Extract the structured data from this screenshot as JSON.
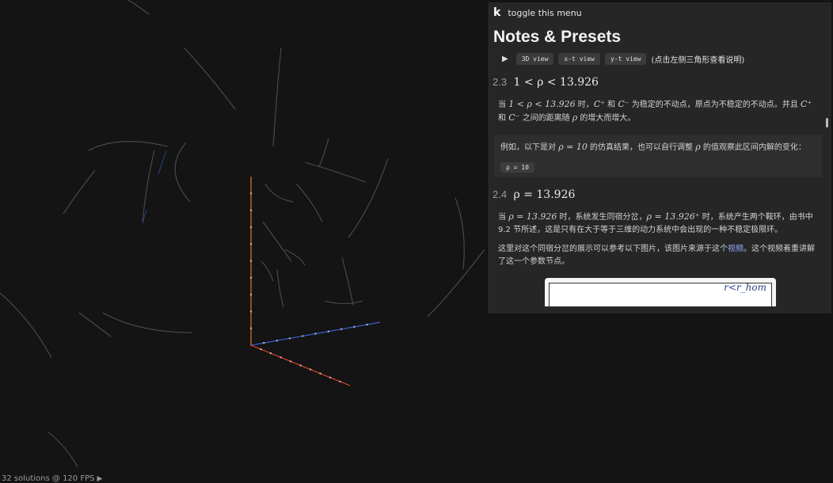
{
  "menu": {
    "toggle_key": "k",
    "toggle_label": "toggle this menu"
  },
  "title": "Notes & Presets",
  "presets": {
    "expand_icon": "triangle-right-icon",
    "buttons": [
      "3D view",
      "x-t view",
      "y-t view"
    ],
    "hint": "(点击左侧三角形查看说明)"
  },
  "sections": [
    {
      "num": "2.3",
      "heading": "1 < ρ < 13.926",
      "p1": {
        "t1": "当 ",
        "m1": "1 < ρ < 13.926",
        "t2": " 时，",
        "m2": "C⁺",
        "t3": " 和 ",
        "m3": "C⁻",
        "t4": " 为稳定的不动点，原点为不稳定的不动点。并且 ",
        "m4": "C⁺",
        "t5": " 和 ",
        "m5": "C⁻",
        "t6": " 之间的距离随 ",
        "m6": "ρ",
        "t7": " 的增大而增大。"
      },
      "box": {
        "t1": "例如，以下是对 ",
        "m1": "ρ = 10",
        "t2": " 的仿真结果，也可以自行调整 ",
        "m2": "ρ",
        "t3": " 的值观察此区间内解的变化：",
        "chip": "ρ = 10"
      }
    },
    {
      "num": "2.4",
      "heading": "ρ = 13.926",
      "p1": {
        "t1": "当 ",
        "m1": "ρ = 13.926",
        "t2": " 时，系统发生同宿分岔，",
        "m2": "ρ = 13.926⁺",
        "t3": " 时，系统产生两个鞍环，由书中 9.2 节所述，这是只有在大于等于三维的动力系统中会出现的一种不稳定极限环。"
      },
      "p2": {
        "t1": "这里对这个同宿分岔的展示可以参考以下图片，该图片来源于这个",
        "link": "视频",
        "t2": "。这个视频着重讲解了这一个参数节点。"
      },
      "image_text": "r<r_hom"
    }
  ],
  "status": {
    "fps_text": "32 solutions @ 120 FPS",
    "play_icon": "play-icon"
  },
  "colors": {
    "axis_x": "#e8442e",
    "axis_y": "#e0772a",
    "axis_z": "#3a5fd0",
    "panel_bg": "#262626",
    "link": "#9aa7ff"
  }
}
